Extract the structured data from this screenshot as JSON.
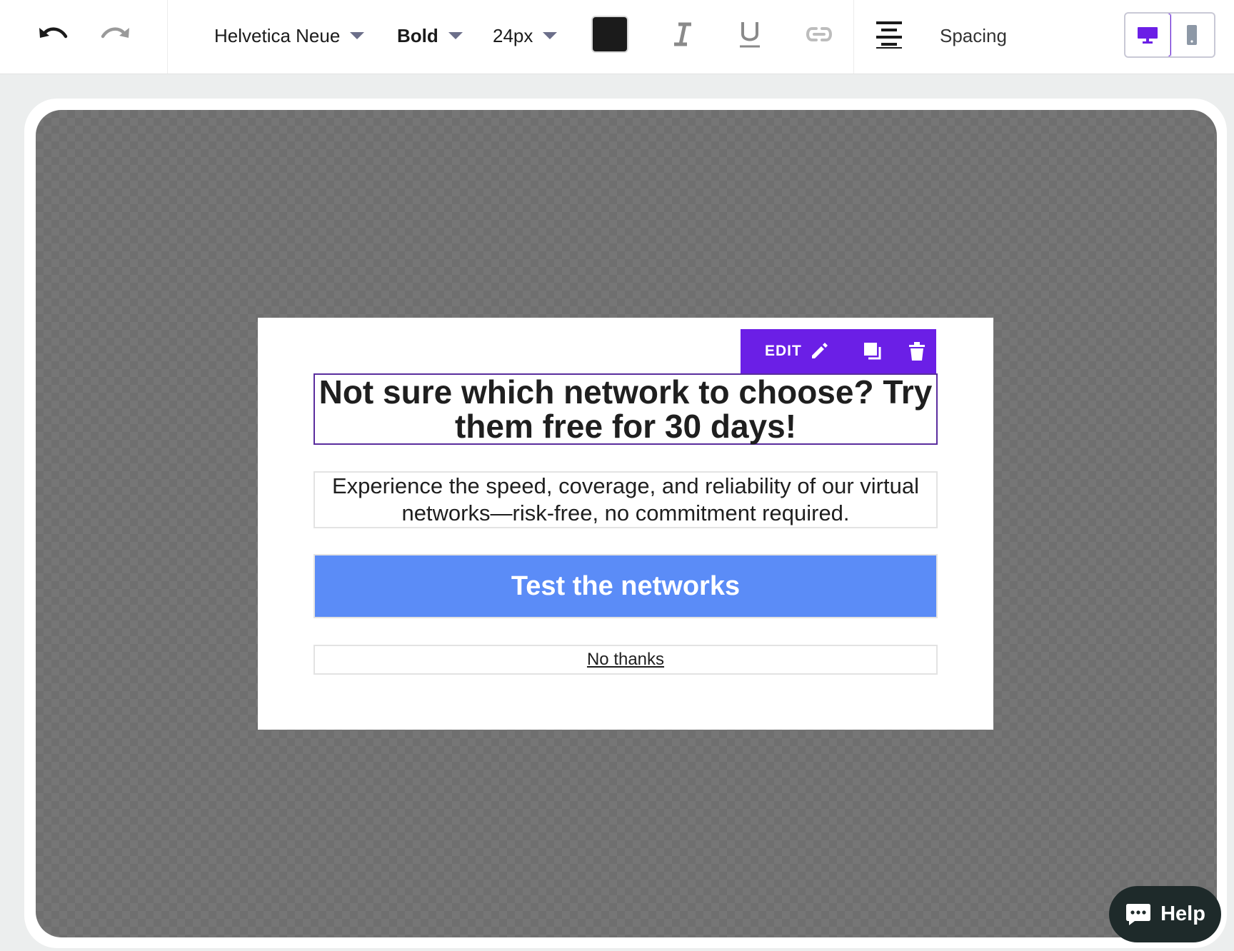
{
  "toolbar": {
    "undo_icon": "undo-icon",
    "redo_icon": "redo-icon",
    "font_family": "Helvetica Neue",
    "font_weight": "Bold",
    "font_size": "24px",
    "text_color": "#1b1b1b",
    "italic_icon": "italic-icon",
    "underline_icon": "underline-icon",
    "link_icon": "link-icon",
    "align_icon": "align-center-icon",
    "spacing_label": "Spacing",
    "device_desktop_icon": "desktop-icon",
    "device_mobile_icon": "mobile-icon"
  },
  "edit_bar": {
    "edit_label": "EDIT",
    "color": "#6b1fe6"
  },
  "popup": {
    "headline": "Not sure which network to choose? Try them free for 30 days!",
    "subtext": "Experience the speed, coverage, and reliability of our virtual networks—risk-free, no commitment required.",
    "cta_label": "Test the networks",
    "cta_color": "#5b8cf7",
    "decline_label": "No thanks"
  },
  "help": {
    "label": "Help"
  }
}
